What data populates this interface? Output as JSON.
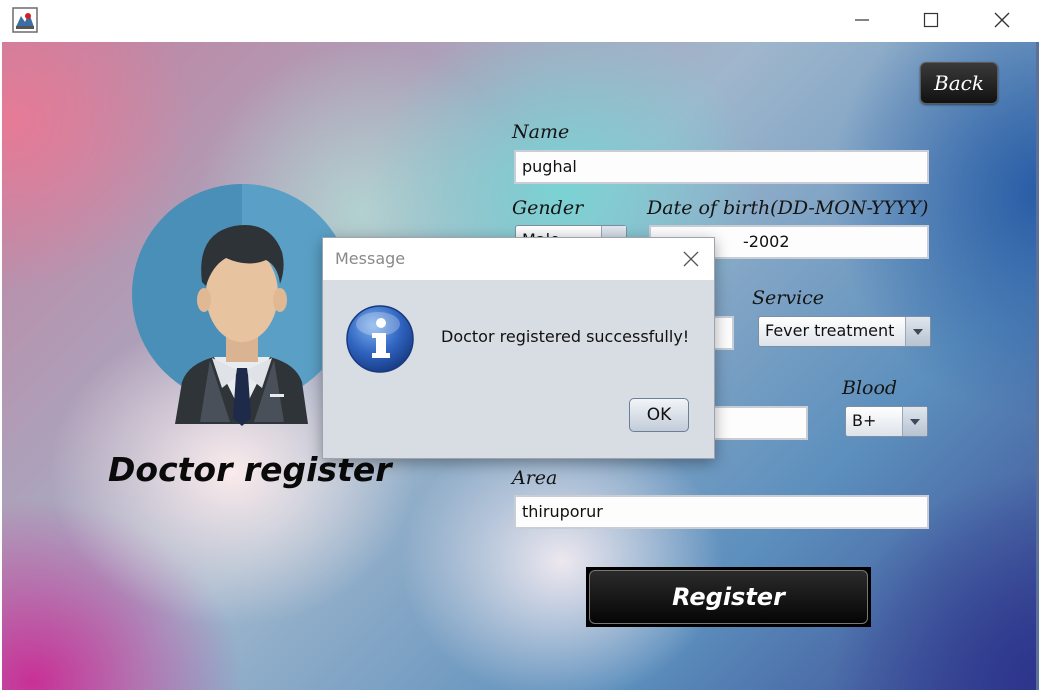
{
  "window": {
    "controls": {
      "minimize": "minimize",
      "maximize": "maximize",
      "close": "close"
    }
  },
  "header": {
    "back_label": "Back"
  },
  "left_panel": {
    "title": "Doctor register"
  },
  "form": {
    "name_label": "Name",
    "name_value": "pughal",
    "gender_label": "Gender",
    "gender_value": "Male",
    "dob_label": "Date of birth(DD-MON-YYYY)",
    "dob_value": "-2002",
    "service_label": "Service",
    "service_value": "Fever treatment",
    "blood_label": "Blood",
    "blood_value": "B+",
    "area_label": "Area",
    "area_value": "thiruporur",
    "register_label": "Register"
  },
  "dialog": {
    "title": "Message",
    "message": "Doctor registered successfully!",
    "ok_label": "OK",
    "icon": "info-icon"
  },
  "colors": {
    "accent_blue": "#2f6bc0",
    "button_dark": "#111111"
  }
}
